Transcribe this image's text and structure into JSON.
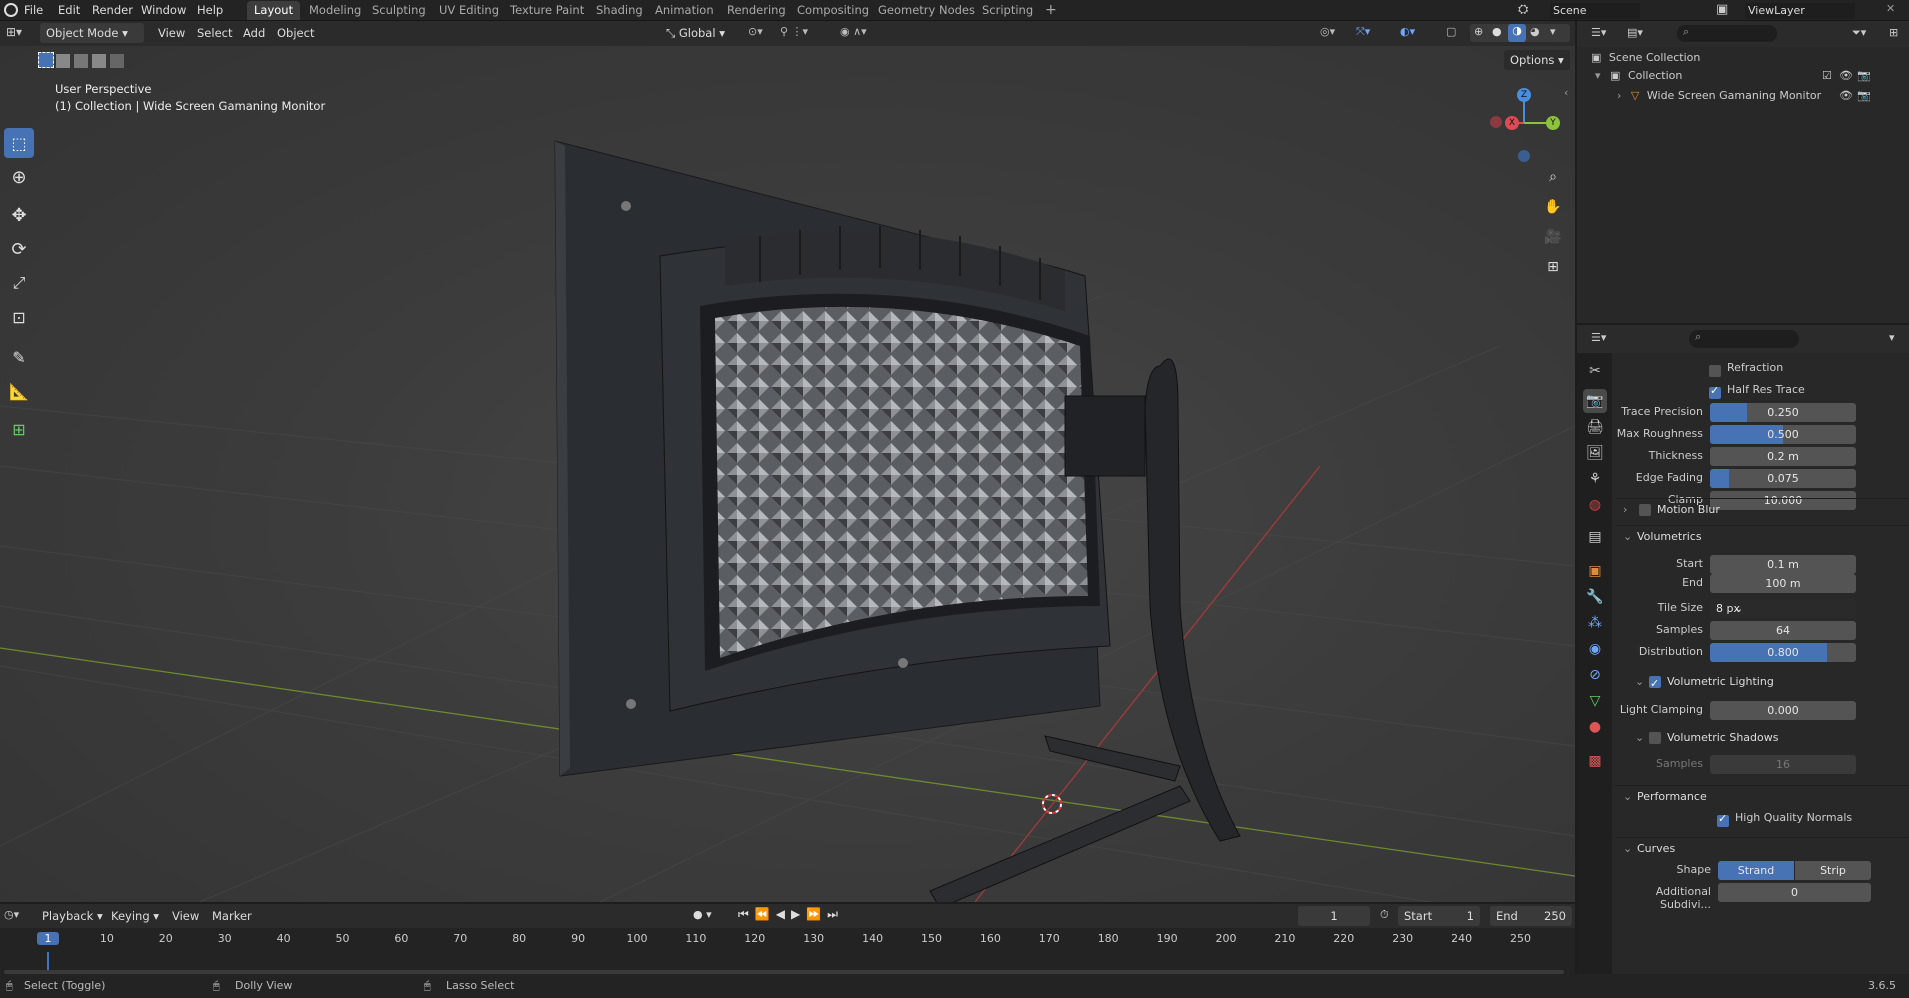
{
  "topbar": {
    "menus": [
      "File",
      "Edit",
      "Render",
      "Window",
      "Help"
    ],
    "workspaces": [
      "Layout",
      "Modeling",
      "Sculpting",
      "UV Editing",
      "Texture Paint",
      "Shading",
      "Animation",
      "Rendering",
      "Compositing",
      "Geometry Nodes",
      "Scripting"
    ],
    "add_workspace": "+",
    "scene": "Scene",
    "view_layer": "ViewLayer"
  },
  "viewport_header": {
    "mode": "Object Mode",
    "menus": [
      "View",
      "Select",
      "Add",
      "Object"
    ],
    "orientation": "Global",
    "options": "Options"
  },
  "viewport": {
    "perspective": "User Perspective",
    "collection_line": "(1) Collection | Wide Screen Gamaning Monitor",
    "gizmo_axes": [
      "Z",
      "X",
      "Y"
    ]
  },
  "outliner": {
    "scene_collection": "Scene Collection",
    "collection": "Collection",
    "object": "Wide Screen Gamaning Monitor"
  },
  "properties": {
    "refraction": {
      "label": "Refraction",
      "checked": false
    },
    "half_res_trace": {
      "label": "Half Res Trace",
      "checked": true
    },
    "fields": [
      {
        "label": "Trace Precision",
        "value": "0.250",
        "fill": 0.25
      },
      {
        "label": "Max Roughness",
        "value": "0.500",
        "fill": 0.5
      },
      {
        "label": "Thickness",
        "value": "0.2 m",
        "fill": 0
      },
      {
        "label": "Edge Fading",
        "value": "0.075",
        "fill": 0.075
      },
      {
        "label": "Clamp",
        "value": "10.000",
        "fill": 0
      }
    ],
    "motion_blur": "Motion Blur",
    "volumetrics": "Volumetrics",
    "vol_fields": [
      {
        "label": "Start",
        "value": "0.1 m",
        "fill": 0
      },
      {
        "label": "End",
        "value": "100 m",
        "fill": 0
      }
    ],
    "tile_size": {
      "label": "Tile Size",
      "value": "8 px"
    },
    "samples": {
      "label": "Samples",
      "value": "64"
    },
    "distribution": {
      "label": "Distribution",
      "value": "0.800",
      "fill": 0.8
    },
    "volumetric_lighting": "Volumetric Lighting",
    "light_clamping": {
      "label": "Light Clamping",
      "value": "0.000"
    },
    "volumetric_shadows": "Volumetric Shadows",
    "shadow_samples": {
      "label": "Samples",
      "value": "16"
    },
    "performance": "Performance",
    "high_quality_normals": "High Quality Normals",
    "curves": "Curves",
    "shape": {
      "label": "Shape",
      "options": [
        "Strand",
        "Strip"
      ],
      "selected": "Strand"
    },
    "additional_subdiv": {
      "label": "Additional Subdivi...",
      "value": "0"
    }
  },
  "timeline": {
    "menus": [
      "Playback",
      "Keying",
      "View",
      "Marker"
    ],
    "current_frame": "1",
    "start_label": "Start",
    "start": "1",
    "end_label": "End",
    "end": "250",
    "ticks": [
      "1",
      "10",
      "20",
      "30",
      "40",
      "50",
      "60",
      "70",
      "80",
      "90",
      "100",
      "110",
      "120",
      "130",
      "140",
      "150",
      "160",
      "170",
      "180",
      "190",
      "200",
      "210",
      "220",
      "230",
      "240",
      "250"
    ]
  },
  "statusbar": {
    "select": "Select (Toggle)",
    "dolly": "Dolly View",
    "lasso": "Lasso Select",
    "version": "3.6.5"
  },
  "colors": {
    "accent": "#4772b3",
    "x_axis": "#e04a55",
    "y_axis": "#8bc33a",
    "z_axis": "#4a8ee0"
  }
}
